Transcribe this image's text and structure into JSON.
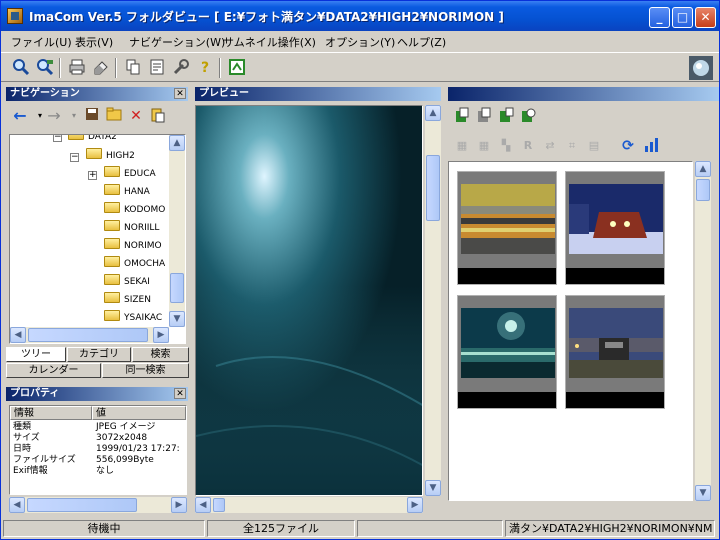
{
  "window": {
    "title": "ImaCom Ver.5 フォルダビュー [ E:¥フォト満タン¥DATA2¥HIGH2¥NORIMON ]"
  },
  "titlebar_buttons": {
    "minimize": "_",
    "maximize": "□",
    "close": "✕"
  },
  "menu": [
    "ファイル(U)",
    "表示(V)",
    "ナビゲーション(W)",
    "サムネイル操作(X)",
    "オプション(Y)",
    "ヘルプ(Z)"
  ],
  "toolbar_icons": [
    "search-icon",
    "search-sub-icon",
    "print-icon",
    "eraser-icon",
    "copy-icon",
    "properties-icon",
    "wrench-icon",
    "help-icon",
    "export-icon",
    "globe-icon"
  ],
  "navigation": {
    "title": "ナビゲーション",
    "tree": [
      {
        "label": "DATA2",
        "level": 0,
        "expander": "−"
      },
      {
        "label": "HIGH2",
        "level": 1,
        "expander": "−"
      },
      {
        "label": "EDUCA",
        "level": 2,
        "expander": "+"
      },
      {
        "label": "HANA",
        "level": 2
      },
      {
        "label": "KODOMO",
        "level": 2
      },
      {
        "label": "NORIILL",
        "level": 2
      },
      {
        "label": "NORIMO",
        "level": 2
      },
      {
        "label": "OMOCHA",
        "level": 2
      },
      {
        "label": "SEKAI",
        "level": 2
      },
      {
        "label": "SIZEN",
        "level": 2
      },
      {
        "label": "YSAIKAC",
        "level": 2
      }
    ],
    "tabs": [
      "ツリー",
      "カテゴリ",
      "検索",
      "カレンダー",
      "同一検索"
    ]
  },
  "properties": {
    "title": "プロパティ",
    "headers": [
      "情報",
      "値"
    ],
    "rows": [
      {
        "key": "種類",
        "value": "JPEG イメージ"
      },
      {
        "key": "サイズ",
        "value": "3072x2048"
      },
      {
        "key": "日時",
        "value": "1999/01/23 17:27:"
      },
      {
        "key": "ファイルサイズ",
        "value": "556,099Byte"
      },
      {
        "key": "Exif情報",
        "value": "なし"
      }
    ]
  },
  "preview": {
    "title": "プレビュー"
  },
  "status": {
    "state": "待機中",
    "file_count": "全125ファイル",
    "path": "満タン¥DATA2¥HIGH2¥NORIMON¥NM"
  }
}
